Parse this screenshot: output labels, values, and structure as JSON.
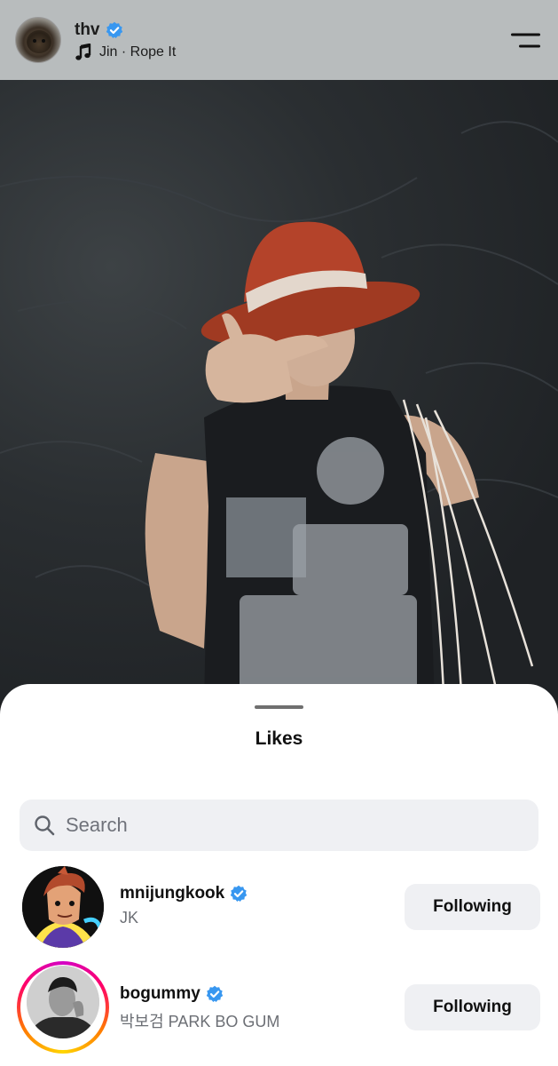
{
  "post": {
    "username": "thv",
    "music": "Jin · Rope It"
  },
  "likes_sheet": {
    "title": "Likes",
    "search_placeholder": "Search",
    "users": [
      {
        "username": "mnijungkook",
        "subtitle": "JK",
        "button": "Following",
        "verified": true,
        "story_ring": false
      },
      {
        "username": "bogummy",
        "subtitle": "박보검 PARK BO GUM",
        "button": "Following",
        "verified": true,
        "story_ring": true
      }
    ]
  },
  "colors": {
    "verified_blue": "#3897f0",
    "sheet_bg": "#ffffff",
    "button_bg": "#eff0f3",
    "header_bg": "#b8bcbd"
  },
  "icons": [
    "verified-badge-icon",
    "music-note-icon",
    "menu-icon",
    "search-icon"
  ]
}
